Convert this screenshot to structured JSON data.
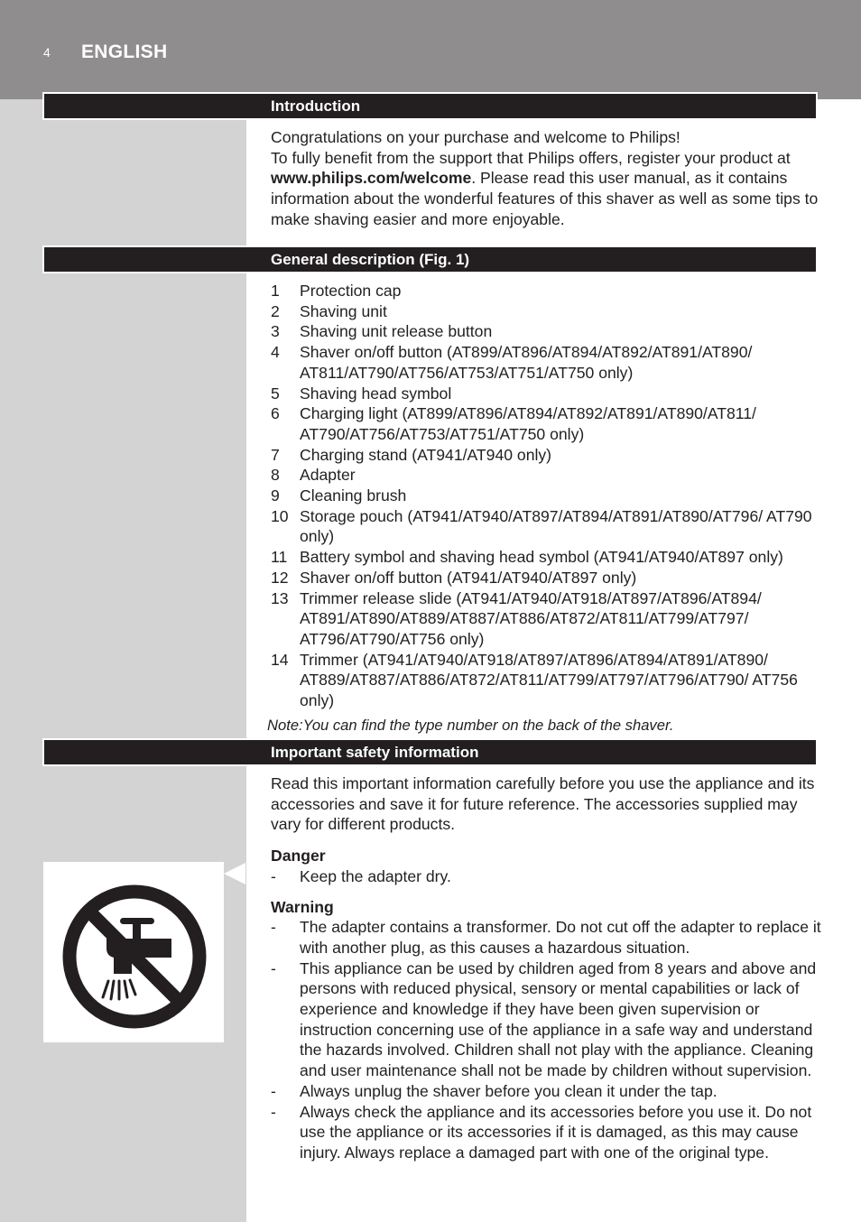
{
  "header": {
    "page_number": "4",
    "language": "ENGLISH"
  },
  "colors": {
    "header_band": "#8f8d8e",
    "left_column": "#d3d3d3",
    "section_bar": "#231f20",
    "text": "#231f20"
  },
  "sections": {
    "introduction": {
      "title": "Introduction",
      "line1": "Congratulations on your purchase and welcome to Philips!",
      "line2_pre": "To fully benefit from the support that Philips offers, register your product at ",
      "link": "www.philips.com/welcome",
      "line2_post": ". Please read this user manual, as it contains information about the wonderful features of this shaver as well as some tips to make shaving easier and more enjoyable."
    },
    "general_description": {
      "title": "General description (Fig. 1)",
      "items": [
        {
          "num": "1",
          "text": "Protection cap"
        },
        {
          "num": "2",
          "text": "Shaving unit"
        },
        {
          "num": "3",
          "text": "Shaving unit release button"
        },
        {
          "num": "4",
          "text": "Shaver on/off button (AT899/AT896/AT894/AT892/AT891/AT890/ AT811/AT790/AT756/AT753/AT751/AT750 only)"
        },
        {
          "num": "5",
          "text": "Shaving head symbol"
        },
        {
          "num": "6",
          "text": "Charging light (AT899/AT896/AT894/AT892/AT891/AT890/AT811/ AT790/AT756/AT753/AT751/AT750 only)"
        },
        {
          "num": "7",
          "text": "Charging stand (AT941/AT940 only)"
        },
        {
          "num": "8",
          "text": "Adapter"
        },
        {
          "num": "9",
          "text": "Cleaning brush"
        },
        {
          "num": "10",
          "text": "Storage pouch (AT941/AT940/AT897/AT894/AT891/AT890/AT796/ AT790 only)"
        },
        {
          "num": "11",
          "text": "Battery symbol and shaving head symbol (AT941/AT940/AT897 only)"
        },
        {
          "num": "12",
          "text": "Shaver on/off button (AT941/AT940/AT897 only)"
        },
        {
          "num": "13",
          "text": "Trimmer release slide (AT941/AT940/AT918/AT897/AT896/AT894/ AT891/AT890/AT889/AT887/AT886/AT872/AT811/AT799/AT797/ AT796/AT790/AT756 only)"
        },
        {
          "num": "14",
          "text": "Trimmer (AT941/AT940/AT918/AT897/AT896/AT894/AT891/AT890/ AT889/AT887/AT886/AT872/AT811/AT799/AT797/AT796/AT790/ AT756 only)"
        }
      ],
      "note": "Note:You can find the type number on the back of the shaver."
    },
    "safety": {
      "title": "Important safety information",
      "intro": "Read this important information carefully before you use the appliance and its accessories and save it for future reference. The accessories supplied may vary for different products.",
      "danger_heading": "Danger",
      "danger_items": [
        "Keep the adapter dry."
      ],
      "warning_heading": "Warning",
      "warning_items": [
        "The adapter contains a transformer. Do not cut off the adapter to replace it with another plug, as this causes a hazardous situation.",
        "This appliance can be used by children aged from 8 years and above and persons with reduced physical, sensory or mental capabilities or lack of experience and knowledge if they have been given supervision or instruction concerning use of the appliance in a safe way and understand the hazards involved. Children shall not play with the appliance. Cleaning and user maintenance shall not be made by children without supervision.",
        "Always unplug the shaver before you clean it under the tap.",
        "Always check the appliance and its accessories before you use it. Do not use the appliance or its accessories if it is damaged, as this may cause injury. Always replace a damaged part with one of the original type."
      ],
      "bullet": "-",
      "icon": "no-water-tap-icon"
    }
  }
}
